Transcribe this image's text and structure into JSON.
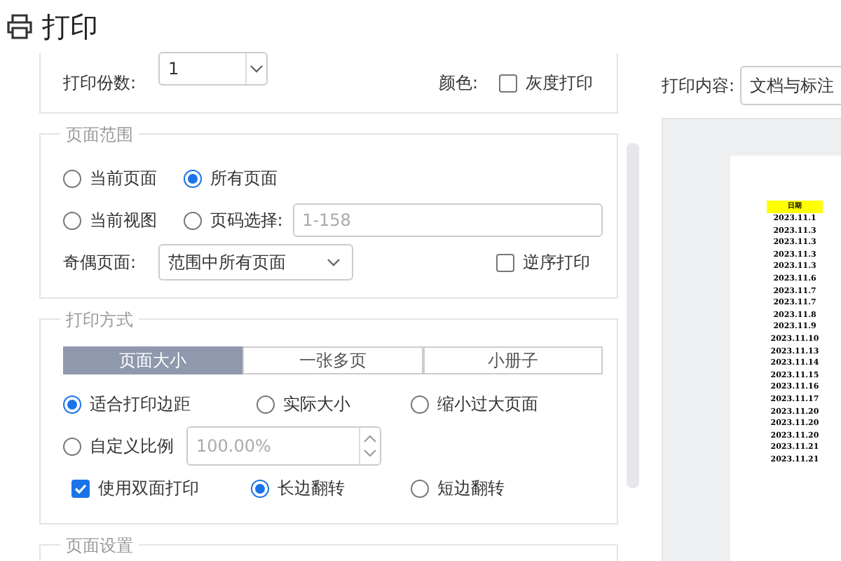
{
  "title": "打印",
  "copies": {
    "label": "打印份数:",
    "value": "1"
  },
  "color": {
    "label": "颜色:",
    "grayscale": {
      "label": "灰度打印",
      "checked": false
    }
  },
  "page_range": {
    "legend": "页面范围",
    "options": [
      {
        "label": "当前页面",
        "selected": false
      },
      {
        "label": "所有页面",
        "selected": true
      },
      {
        "label": "当前视图",
        "selected": false
      },
      {
        "label": "页码选择:",
        "selected": false
      }
    ],
    "page_input": {
      "placeholder": "1-158"
    },
    "odd_even": {
      "label": "奇偶页面:",
      "value": "范围中所有页面"
    },
    "reverse": {
      "label": "逆序打印",
      "checked": false
    }
  },
  "print_mode": {
    "legend": "打印方式",
    "tabs": [
      {
        "label": "页面大小",
        "selected": true
      },
      {
        "label": "一张多页",
        "selected": false
      },
      {
        "label": "小册子",
        "selected": false
      }
    ],
    "scale_options": [
      {
        "label": "适合打印边距",
        "selected": true
      },
      {
        "label": "实际大小",
        "selected": false
      },
      {
        "label": "缩小过大页面",
        "selected": false
      },
      {
        "label": "自定义比例",
        "selected": false
      }
    ],
    "custom_scale": {
      "value": "100.00%",
      "disabled": true
    },
    "duplex": {
      "label": "使用双面打印",
      "checked": true
    },
    "flip": [
      {
        "label": "长边翻转",
        "selected": true
      },
      {
        "label": "短边翻转",
        "selected": false
      }
    ]
  },
  "page_setup": {
    "legend": "页面设置"
  },
  "print_content": {
    "label": "打印内容:",
    "value": "文档与标注"
  },
  "preview": {
    "column_header": "日期",
    "rows": [
      "2023.11.1",
      "2023.11.3",
      "2023.11.3",
      "2023.11.3",
      "2023.11.3",
      "2023.11.6",
      "2023.11.7",
      "2023.11.7",
      "2023.11.8",
      "2023.11.9",
      "2023.11.10",
      "2023.11.13",
      "2023.11.14",
      "2023.11.15",
      "2023.11.16",
      "2023.11.17",
      "2023.11.20",
      "2023.11.20",
      "2023.11.20",
      "2023.11.21",
      "2023.11.21"
    ]
  }
}
